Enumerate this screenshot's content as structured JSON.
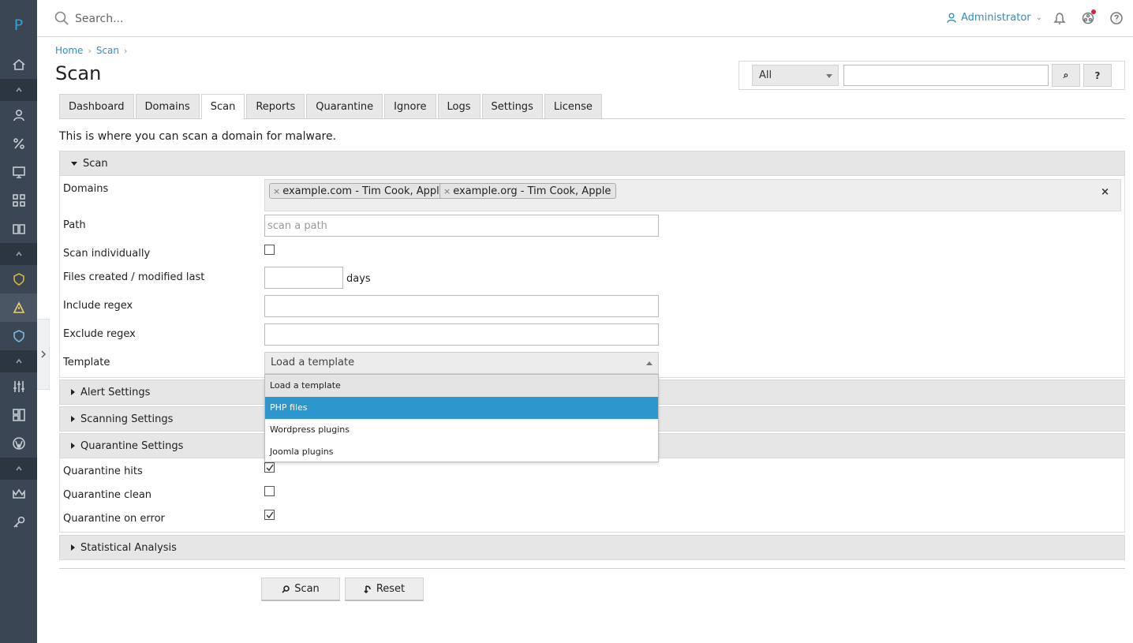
{
  "brand": {
    "logo_letter": "P"
  },
  "topbar": {
    "search_placeholder": "Search...",
    "user_label": "Administrator",
    "user_caret": "⌄"
  },
  "breadcrumb": {
    "home": "Home",
    "scan": "Scan"
  },
  "page": {
    "title": "Scan",
    "intro": "This is where you can scan a domain for malware."
  },
  "search_panel": {
    "filter_value": "All",
    "search_button": "⌕",
    "help_button": "?"
  },
  "tabs": [
    "Dashboard",
    "Domains",
    "Scan",
    "Reports",
    "Quarantine",
    "Ignore",
    "Logs",
    "Settings",
    "License"
  ],
  "active_tab": "Scan",
  "scan_section": {
    "title": "Scan",
    "domains_label": "Domains",
    "domain_tags": [
      "example.com - Tim Cook, Apple",
      "example.org - Tim Cook, Apple"
    ],
    "clear_label": "×",
    "path_label": "Path",
    "path_placeholder": "scan a path",
    "scan_individually_label": "Scan individually",
    "scan_individually_checked": false,
    "files_label": "Files created / modified last",
    "days_label": "days",
    "include_label": "Include regex",
    "exclude_label": "Exclude regex",
    "template_label": "Template",
    "template_value": "Load a template",
    "template_options": [
      "Load a template",
      "PHP files",
      "Wordpress plugins",
      "Joomla plugins"
    ],
    "template_highlighted": "PHP files"
  },
  "alert_section": {
    "title": "Alert Settings"
  },
  "scanning_section": {
    "title": "Scanning Settings"
  },
  "quarantine_section": {
    "title": "Quarantine Settings",
    "hits_label": "Quarantine hits",
    "hits_checked": true,
    "clean_label": "Quarantine clean",
    "clean_checked": false,
    "error_label": "Quarantine on error",
    "error_checked": true
  },
  "stats_section": {
    "title": "Statistical Analysis"
  },
  "actions": {
    "scan_label": "Scan",
    "reset_label": "Reset"
  },
  "colors": {
    "sidebar_bg": "#3a4654",
    "accent": "#2d96cd",
    "link": "#2d8fc4",
    "notification": "#d9213d"
  }
}
